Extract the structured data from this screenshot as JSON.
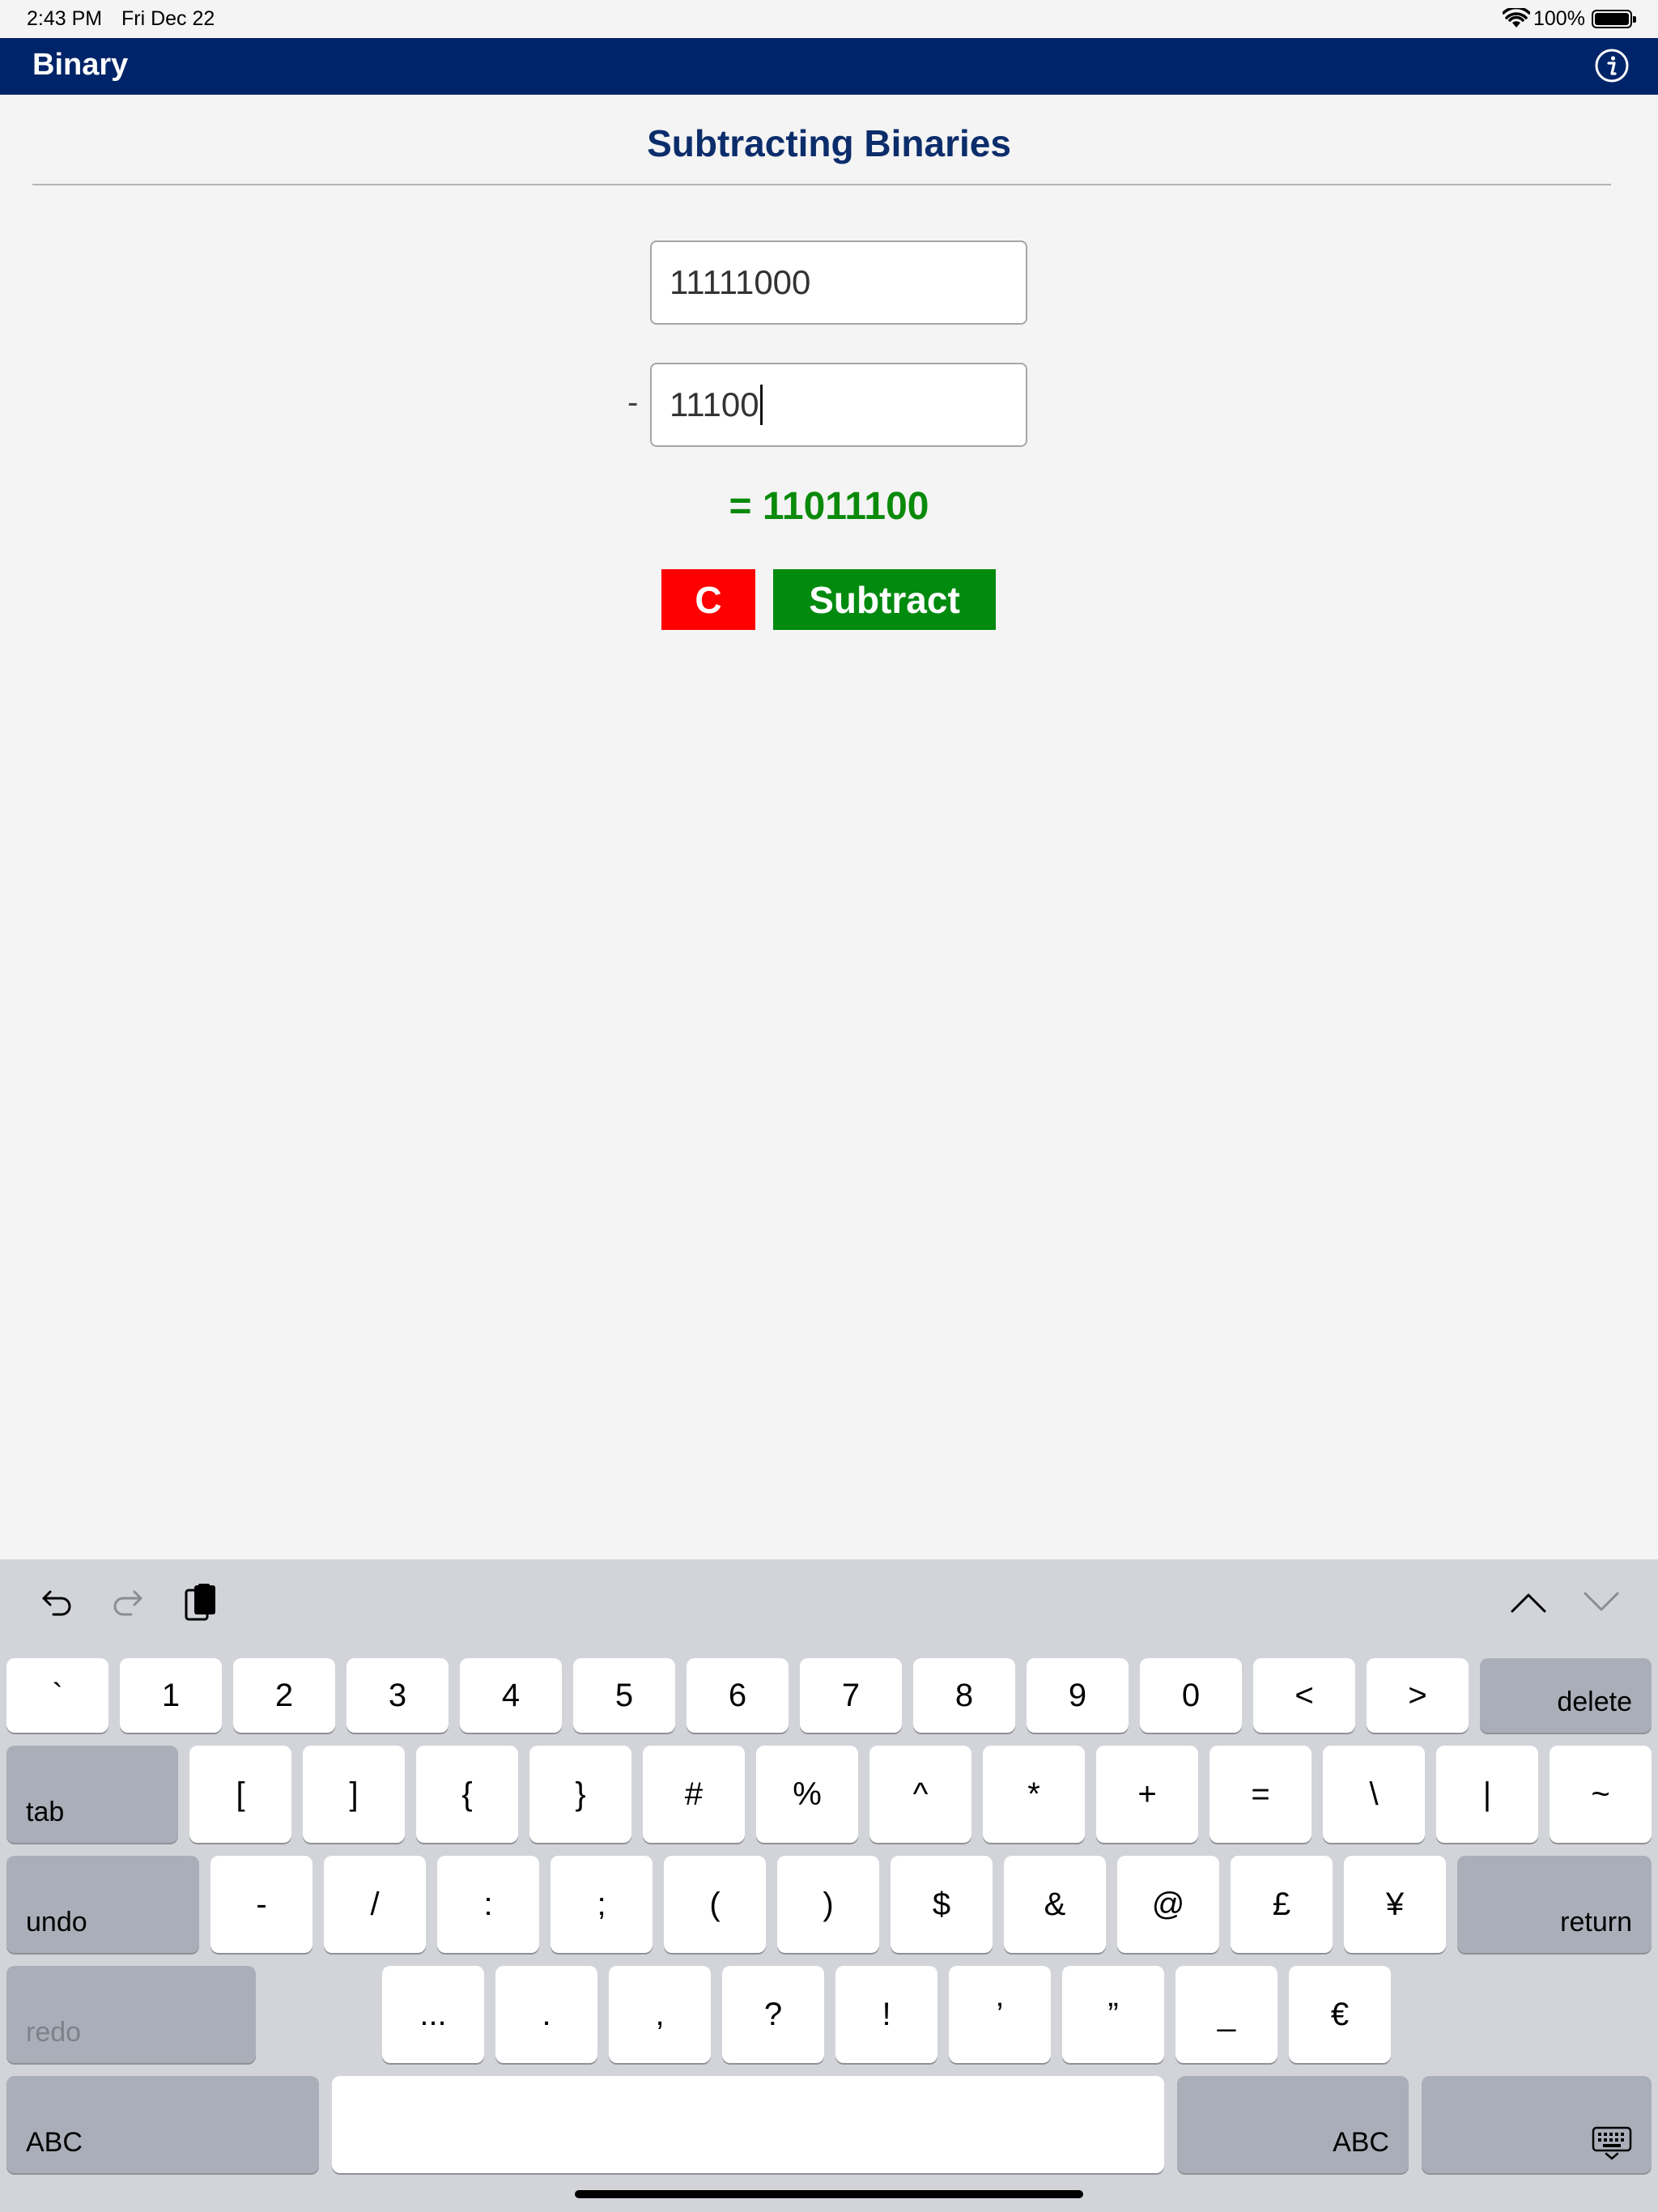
{
  "status_bar": {
    "time": "2:43 PM",
    "date": "Fri Dec 22",
    "battery_percent": "100%"
  },
  "nav": {
    "title": "Binary",
    "info_icon": "info-icon"
  },
  "main": {
    "title": "Subtracting Binaries",
    "first_value": "11111000",
    "operator": "-",
    "second_value": "11100",
    "result": "= 11011100",
    "clear_label": "C",
    "subtract_label": "Subtract"
  },
  "colors": {
    "nav": "#002469",
    "title": "#0c2d6b",
    "result": "#0a8a0a",
    "clear_button": "#ff0000",
    "subtract_button": "#008a0e"
  },
  "keyboard": {
    "row1": [
      "`",
      "1",
      "2",
      "3",
      "4",
      "5",
      "6",
      "7",
      "8",
      "9",
      "0",
      "<",
      ">"
    ],
    "delete": "delete",
    "tab": "tab",
    "row2": [
      "[",
      "]",
      "{",
      "}",
      "#",
      "%",
      "^",
      "*",
      "+",
      "=",
      "\\",
      "|",
      "~"
    ],
    "undo": "undo",
    "row3": [
      "-",
      "/",
      ":",
      ";",
      "(",
      ")",
      "$",
      "&",
      "@",
      "£",
      "¥"
    ],
    "return": "return",
    "redo": "redo",
    "row4": [
      "...",
      ".",
      ",",
      "?",
      "!",
      "’",
      "”",
      "_",
      "€"
    ],
    "abc_left": "ABC",
    "abc_right": "ABC"
  }
}
